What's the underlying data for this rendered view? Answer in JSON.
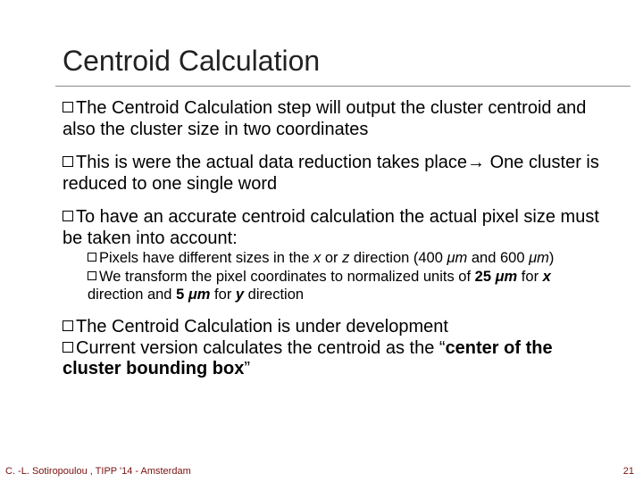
{
  "title": "Centroid Calculation",
  "bullets": [
    {
      "lead": "The",
      "rest_html": " Centroid Calculation step will output the cluster centroid and also the cluster size in two coordinates"
    },
    {
      "lead": "This",
      "rest_html": " is were the actual data reduction takes place→ One cluster is reduced to one single word"
    },
    {
      "lead": "To",
      "rest_html": " have an accurate centroid calculation the actual pixel size must be taken into account:",
      "subs": [
        {
          "lead": "Pixels",
          "rest_html": " have different sizes in the <i>x</i> or <i>z</i> direction (400 <i>μm</i> and 600 <i>μm</i>)"
        },
        {
          "lead": "We",
          "rest_html": " transform the pixel coordinates  to normalized units of <b>25 <i>μm</i></b> for <b><i>x</i></b> direction and <b>5 <i>μm</i></b> for <b><i>y</i></b> direction"
        }
      ]
    },
    {
      "lead": "The",
      "rest_html": " Centroid Calculation is under development"
    },
    {
      "lead": "Current",
      "rest_html": " version calculates the centroid as the “<b>center of the cluster bounding box</b>”"
    }
  ],
  "footer": "C. -L. Sotiropoulou , TIPP '14 - Amsterdam",
  "page_number": "21"
}
